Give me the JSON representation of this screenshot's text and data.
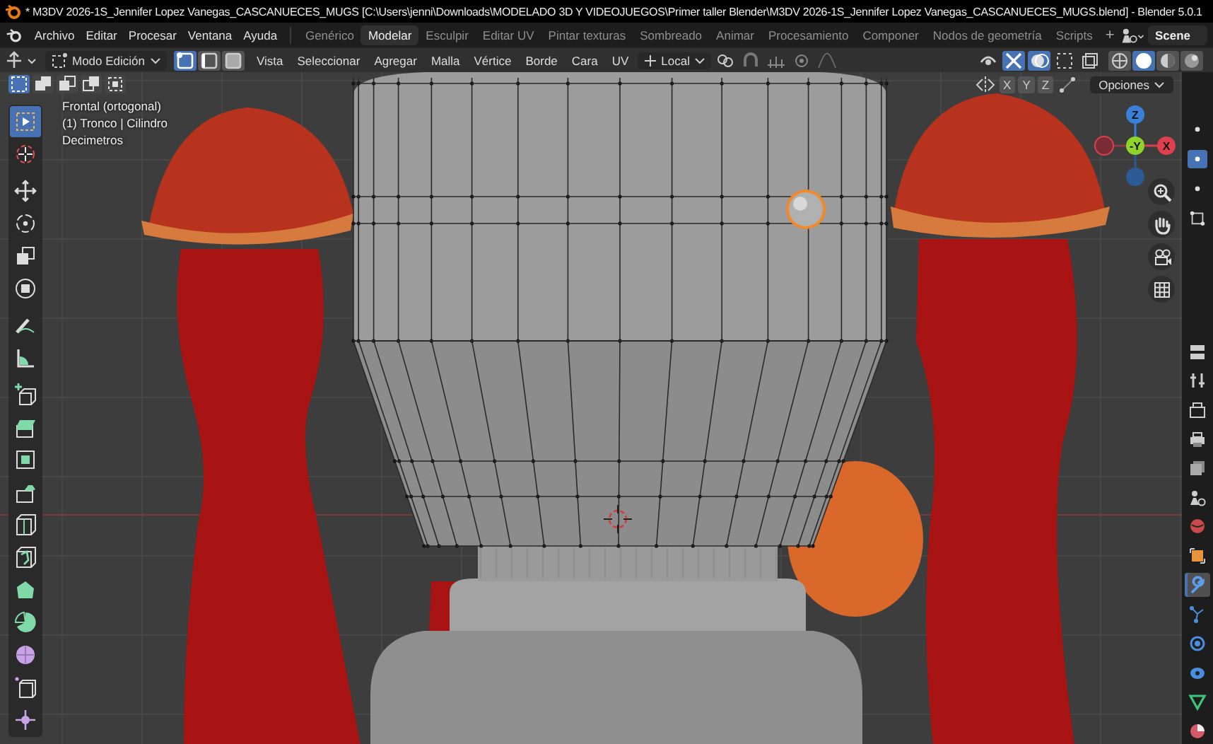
{
  "window": {
    "title": "* M3DV 2026-1S_Jennifer Lopez Vanegas_CASCANUECES_MUGS [C:\\Users\\jenni\\Downloads\\MODELADO 3D Y VIDEOJUEGOS\\Primer taller Blender\\M3DV 2026-1S_Jennifer Lopez Vanegas_CASCANUECES_MUGS.blend] - Blender 5.0.1"
  },
  "menu": [
    "Archivo",
    "Editar",
    "Procesar",
    "Ventana",
    "Ayuda"
  ],
  "workspaces": [
    {
      "label": "Genérico",
      "selected": false
    },
    {
      "label": "Modelar",
      "selected": true
    },
    {
      "label": "Esculpir",
      "selected": false
    },
    {
      "label": "Editar UV",
      "selected": false
    },
    {
      "label": "Pintar texturas",
      "selected": false
    },
    {
      "label": "Sombreado",
      "selected": false
    },
    {
      "label": "Animar",
      "selected": false
    },
    {
      "label": "Procesamiento",
      "selected": false
    },
    {
      "label": "Componer",
      "selected": false
    },
    {
      "label": "Nodos de geometría",
      "selected": false
    },
    {
      "label": "Scripts",
      "selected": false
    }
  ],
  "add_workspace": "+",
  "scene": "Scene",
  "header": {
    "mode": "Modo Edición",
    "select_modes": [
      {
        "selected": true
      },
      {
        "selected": false
      },
      {
        "selected": false
      }
    ],
    "menus": [
      "Vista",
      "Seleccionar",
      "Agregar",
      "Malla",
      "Vértice",
      "Borde",
      "Cara",
      "UV"
    ],
    "orientation": "Local"
  },
  "tool_header": {
    "select_modes": [
      {
        "selected": true
      },
      {
        "selected": false
      },
      {
        "selected": false
      },
      {
        "selected": false
      },
      {
        "selected": false
      }
    ],
    "axes": [
      "X",
      "Y",
      "Z"
    ],
    "options": "Opciones"
  },
  "overlay_text": [
    "Frontal (ortogonal)",
    "(1) Tronco | Cilindro",
    "Decimetros"
  ],
  "gizmo": {
    "z": "Z",
    "y": "-Y",
    "x": "X"
  },
  "tools": [
    {
      "selected": true
    },
    {
      "selected": false
    },
    {
      "selected": false
    },
    {
      "selected": false
    },
    {
      "selected": false
    },
    {
      "selected": false
    },
    {
      "selected": false
    },
    {
      "selected": false
    },
    {
      "selected": false
    },
    {
      "selected": false
    },
    {
      "selected": false
    },
    {
      "selected": false
    },
    {
      "selected": false
    },
    {
      "selected": false
    },
    {
      "selected": false
    },
    {
      "selected": false
    },
    {
      "selected": false
    },
    {
      "selected": false
    },
    {
      "selected": false
    }
  ],
  "properties_tabs": [
    {
      "selected": false
    },
    {
      "selected": false
    },
    {
      "selected": false
    },
    {
      "selected": false
    },
    {
      "selected": false
    },
    {
      "selected": false
    },
    {
      "selected": false
    },
    {
      "selected": false
    },
    {
      "selected": true
    },
    {
      "selected": false
    },
    {
      "selected": false
    },
    {
      "selected": false
    },
    {
      "selected": false
    },
    {
      "selected": false
    }
  ]
}
